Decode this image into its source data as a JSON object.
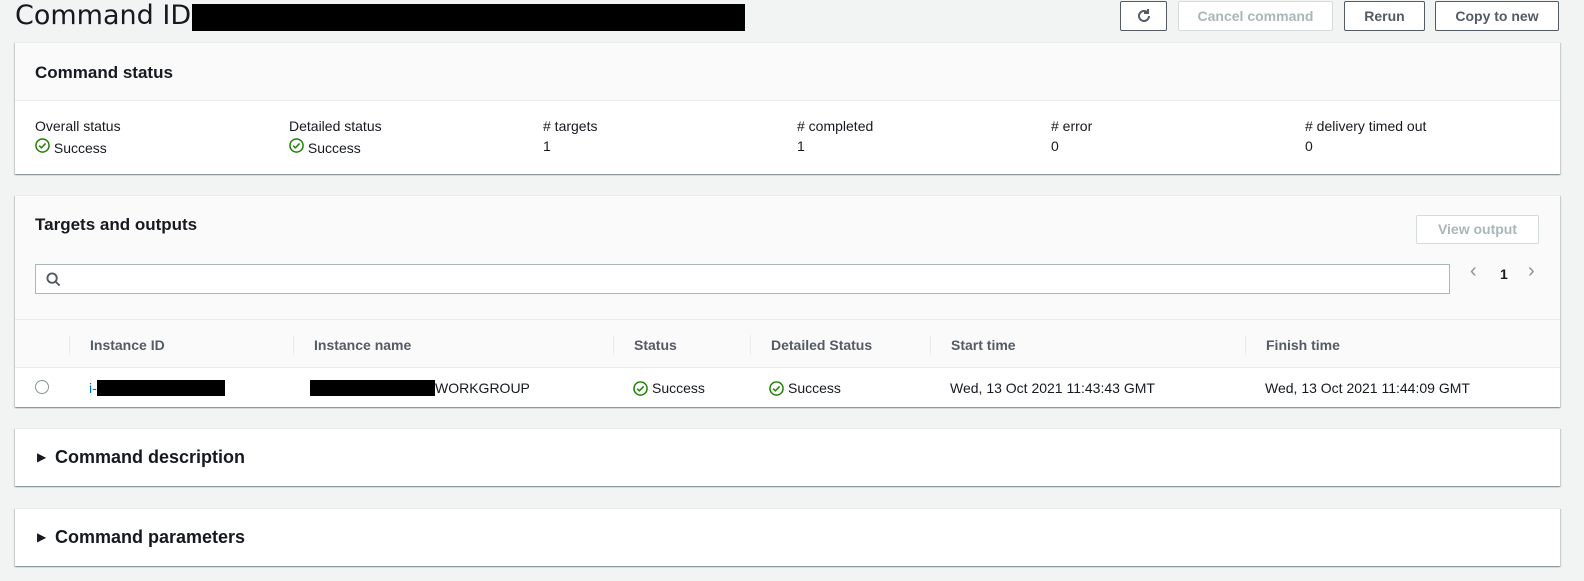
{
  "header": {
    "title": "Command ID:",
    "buttons": {
      "refresh_icon": "refresh-icon",
      "cancel": "Cancel command",
      "rerun": "Rerun",
      "copy": "Copy to new"
    }
  },
  "command_status": {
    "title": "Command status",
    "stats": [
      {
        "label": "Overall status",
        "value": "Success"
      },
      {
        "label": "Detailed status",
        "value": "Success"
      },
      {
        "label": "# targets",
        "value": "1"
      },
      {
        "label": "# completed",
        "value": "1"
      },
      {
        "label": "# error",
        "value": "0"
      },
      {
        "label": "# delivery timed out",
        "value": "0"
      }
    ]
  },
  "targets": {
    "title": "Targets and outputs",
    "view_output": "View output",
    "search": {
      "placeholder": ""
    },
    "pager": {
      "prev": "‹",
      "page": "1",
      "next": "›"
    },
    "columns": [
      "Instance ID",
      "Instance name",
      "Status",
      "Detailed Status",
      "Start time",
      "Finish time"
    ],
    "rows": [
      {
        "instance_id_prefix": "i-",
        "instance_name_suffix": "WORKGROUP",
        "status": "Success",
        "detailed_status": "Success",
        "start_time": "Wed, 13 Oct 2021 11:43:43 GMT",
        "finish_time": "Wed, 13 Oct 2021 11:44:09 GMT"
      }
    ]
  },
  "sections": {
    "description": "Command description",
    "parameters": "Command parameters"
  },
  "colors": {
    "success": "#1d8102",
    "link": "#0073bb",
    "background": "#f2f3f3"
  }
}
